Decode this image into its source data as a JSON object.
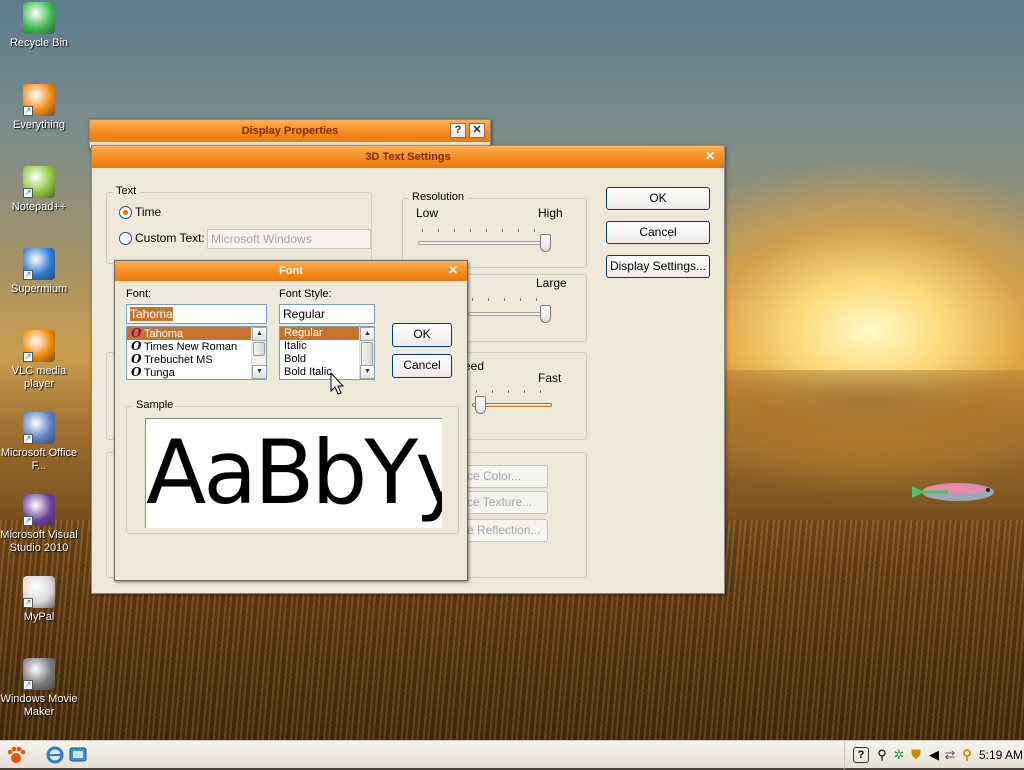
{
  "desktop": {
    "icons": [
      {
        "label": "Recycle Bin",
        "icon": "recycle-bin-icon",
        "color": "#3cba54"
      },
      {
        "label": "Everything",
        "icon": "everything-search-icon",
        "color": "#f28a10"
      },
      {
        "label": "Notepad++",
        "icon": "notepad-plus-plus-icon",
        "color": "#8fc63f"
      },
      {
        "label": "Supermium",
        "icon": "supermium-browser-icon",
        "color": "#2a7bd5"
      },
      {
        "label": "VLC media player",
        "icon": "vlc-cone-icon",
        "color": "#f08a00"
      },
      {
        "label": "Microsoft Office F...",
        "icon": "office-document-icon",
        "color": "#5b7fc2"
      },
      {
        "label": "Microsoft Visual Studio 2010",
        "icon": "visual-studio-icon",
        "color": "#6a3fa0"
      },
      {
        "label": "MyPal",
        "icon": "mypal-browser-icon",
        "color": "#d9d9d9"
      },
      {
        "label": "Windows Movie Maker",
        "icon": "movie-maker-icon",
        "color": "#7a7a7a"
      }
    ]
  },
  "display_properties": {
    "title": "Display Properties",
    "help_glyph": "?",
    "close_glyph": "✕"
  },
  "text_settings": {
    "title": "3D Text Settings",
    "close_glyph": "✕",
    "text_group": "Text",
    "time_label": "Time",
    "custom_text_label": "Custom Text:",
    "custom_text_value": "Microsoft Windows",
    "resolution_group": "Resolution",
    "resolution_low": "Low",
    "resolution_high": "High",
    "size_large": "Large",
    "speed_partial": "eed",
    "speed_fast": "Fast",
    "surface_color": "ce Color...",
    "surface_texture": "ce Texture...",
    "surface_reflection": "e Reflection...",
    "ok": "OK",
    "cancel": "Cancel",
    "display_settings": "Display Settings..."
  },
  "font_dialog": {
    "title": "Font",
    "close_glyph": "✕",
    "font_label": "Font:",
    "font_value": "Tahoma",
    "fonts": [
      "Tahoma",
      "Times New Roman",
      "Trebuchet MS",
      "Tunga"
    ],
    "font_glyph": "O",
    "style_label": "Font Style:",
    "style_value": "Regular",
    "styles": [
      "Regular",
      "Italic",
      "Bold",
      "Bold Italic"
    ],
    "ok": "OK",
    "cancel": "Cancel",
    "sample_group": "Sample",
    "sample_text": "AaBbYy"
  },
  "taskbar": {
    "clock": "5:19 AM",
    "start_icon": "paw-start-icon",
    "quicklaunch": [
      "internet-explorer-icon",
      "show-desktop-icon"
    ]
  }
}
